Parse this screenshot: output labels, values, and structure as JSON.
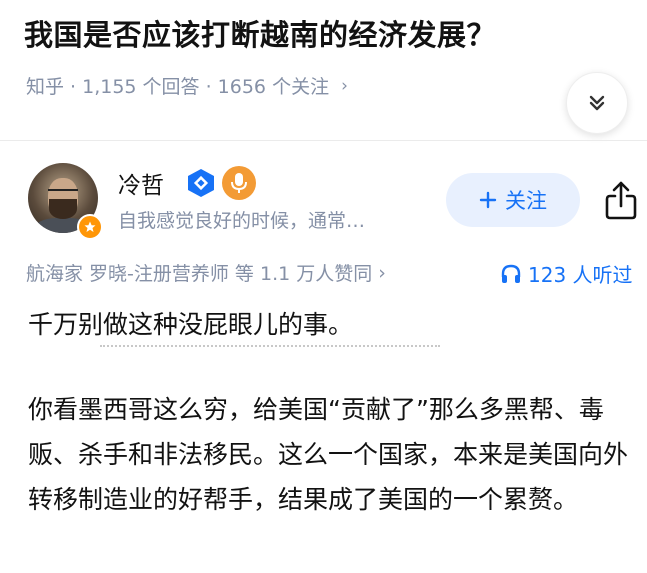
{
  "question": {
    "title": "我国是否应该打断越南的经济发展？",
    "meta": "知乎 · 1,155 个回答 · 1656 个关注",
    "meta_chevron": "›"
  },
  "author": {
    "name": "冷哲",
    "bio": "自我感觉良好的时候，通常…",
    "follow_label": "关注",
    "follow_icon": "plus-icon"
  },
  "voters": {
    "text": "航海家 罗晓-注册营养师 等 1.1 万人赞同",
    "chevron": "›"
  },
  "listen": {
    "text": "123 人听过",
    "icon": "headphones-icon"
  },
  "answer": {
    "paragraph1": "千万别做这种没屁眼儿的事。",
    "paragraph2": "你看墨西哥这么穷，给美国“贡献了”那么多黑帮、毒贩、杀手和非法移民。这么一个国家，本来是美国向外转移制造业的好帮手，结果成了美国的一个累赘。"
  },
  "colors": {
    "accent": "#1772f6",
    "follow_bg": "#e8f0fe",
    "meta_gray": "#8590a6",
    "badge_orange": "#ff9607"
  }
}
